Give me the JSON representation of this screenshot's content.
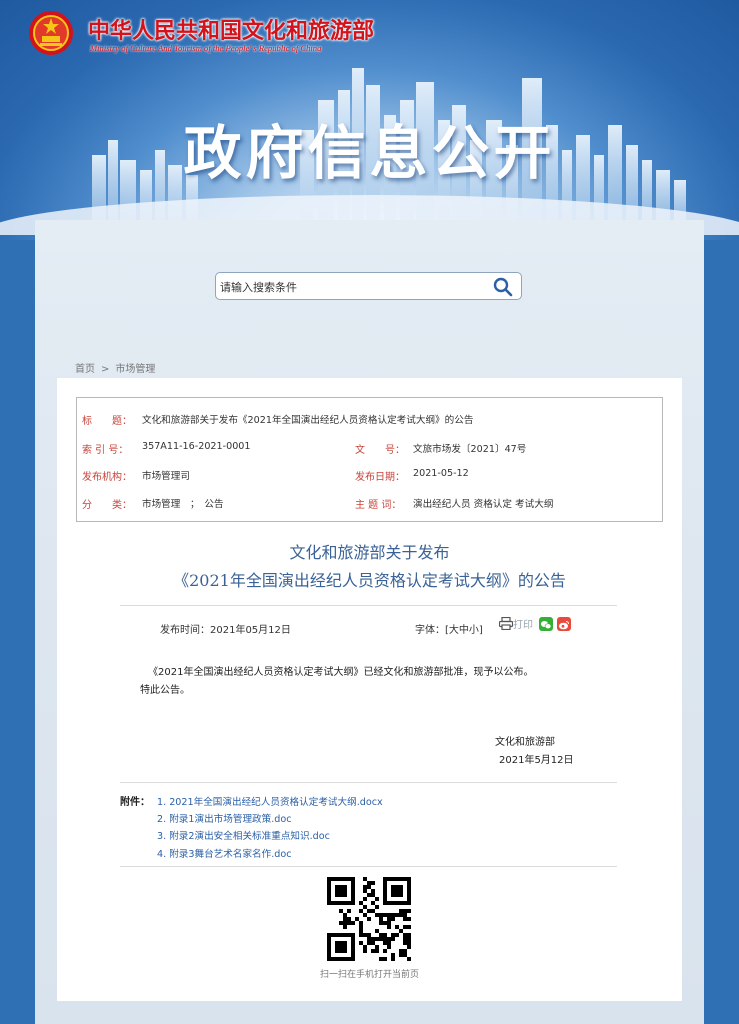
{
  "header": {
    "site_name": "中华人民共和国文化和旅游部",
    "site_name_en": "Ministry of Culture And Tourism of the People' s Republic of China",
    "banner_title": "政府信息公开"
  },
  "search": {
    "placeholder": "请输入搜索条件"
  },
  "breadcrumb": {
    "home": "首页",
    "separator": ">",
    "section": "市场管理"
  },
  "meta": {
    "title_label": "标　　题：",
    "title_value": "文化和旅游部关于发布《2021年全国演出经纪人员资格认定考试大纲》的公告",
    "index_label": "索 引 号：",
    "index_value": "357A11-16-2021-0001",
    "doc_no_label": "文　　号：",
    "doc_no_value": "文旅市场发〔2021〕47号",
    "org_label": "发布机构：",
    "org_value": "市场管理司",
    "date_label": "发布日期：",
    "date_value": "2021-05-12",
    "category_label": "分　　类：",
    "category_value": "市场管理　；　公告",
    "keywords_label": "主 题 词：",
    "keywords_value": "演出经纪人员 资格认定 考试大纲"
  },
  "article": {
    "title_line1": "文化和旅游部关于发布",
    "title_line2": "《2021年全国演出经纪人员资格认定考试大纲》的公告",
    "publish_time": "发布时间：2021年05月12日",
    "font_size": "字体：[大中小]",
    "print_label": "打印",
    "paragraph1": "《2021年全国演出经纪人员资格认定考试大纲》已经文化和旅游部批准，现予以公布。",
    "paragraph2": "特此公告。",
    "signature_org": "文化和旅游部",
    "signature_date": "2021年5月12日"
  },
  "attachments": {
    "label": "附件：",
    "items": [
      "1. 2021年全国演出经纪人员资格认定考试大纲.docx",
      "2. 附录1演出市场管理政策.doc",
      "3. 附录2演出安全相关标准重点知识.doc",
      "4. 附录3舞台艺术名家名作.doc"
    ]
  },
  "qr": {
    "caption": "扫一扫在手机打开当前页"
  },
  "colors": {
    "brand_red": "#d3131b",
    "title_blue": "#3a6296",
    "link_blue": "#2b5fa6",
    "label_red": "#c8433a"
  }
}
